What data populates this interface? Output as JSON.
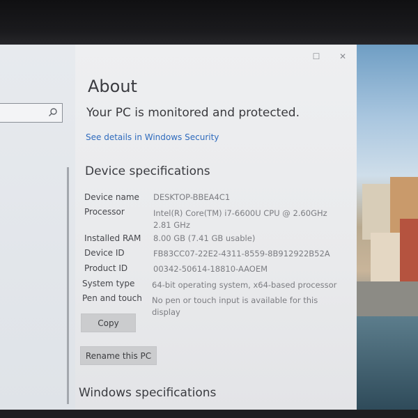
{
  "window": {
    "caption_buttons": {
      "restore": "☐",
      "close": "✕"
    }
  },
  "nav": {
    "search_placeholder": "",
    "icons": {
      "search": "search-icon"
    }
  },
  "page": {
    "title": "About",
    "protection_status": "Your PC is monitored and protected.",
    "security_link": "See details in Windows Security"
  },
  "device_specs": {
    "heading": "Device specifications",
    "rows": [
      {
        "label": "Device name",
        "value": "DESKTOP-BBEA4C1"
      },
      {
        "label": "Processor",
        "value": "Intel(R) Core(TM) i7-6600U CPU @ 2.60GHz   2.81 GHz"
      },
      {
        "label": "Installed RAM",
        "value": "8.00 GB (7.41 GB usable)"
      },
      {
        "label": "Device ID",
        "value": "FB83CC07-22E2-4311-8559-8B912922B52A"
      },
      {
        "label": "Product ID",
        "value": "00342-50614-18810-AAOEM"
      },
      {
        "label": "System type",
        "value": "64-bit operating system, x64-based processor"
      },
      {
        "label": "Pen and touch",
        "value": "No pen or touch input is available for this display"
      }
    ],
    "copy_label": "Copy",
    "rename_label": "Rename this PC"
  },
  "windows_specs": {
    "heading": "Windows specifications"
  },
  "colors": {
    "link": "#2f6bbd",
    "content_bg": "#eeeff1",
    "nav_bg": "#e7eaee",
    "button_bg": "#cbccce"
  }
}
